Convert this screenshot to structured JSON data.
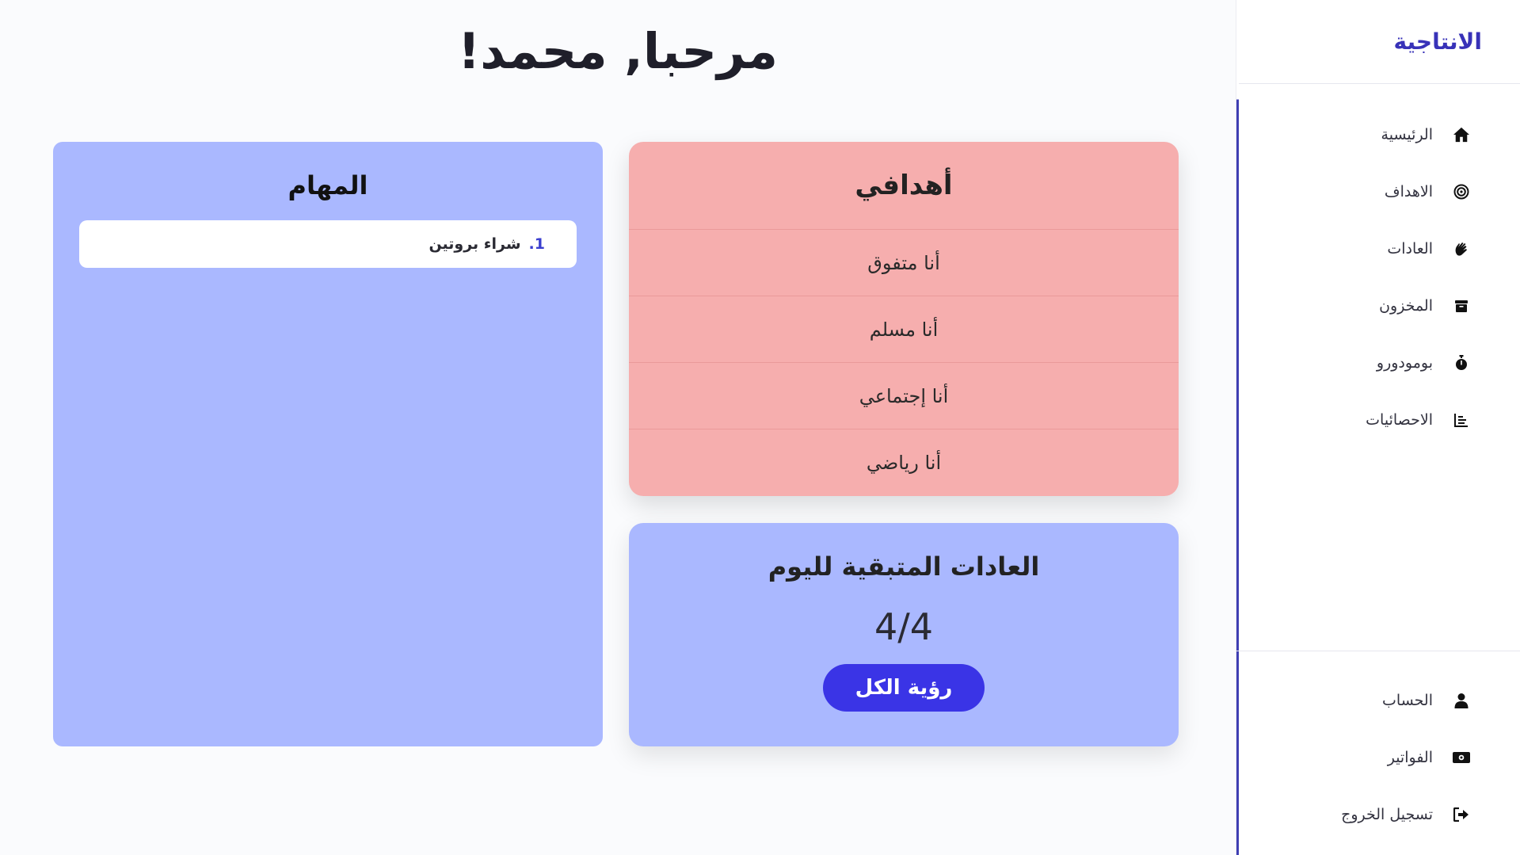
{
  "app": {
    "brand": "الانتاجية"
  },
  "sidebar": {
    "items": [
      {
        "label": "الرئيسية",
        "icon": "home-icon"
      },
      {
        "label": "الاهداف",
        "icon": "target-icon"
      },
      {
        "label": "العادات",
        "icon": "hand-icon"
      },
      {
        "label": "المخزون",
        "icon": "box-icon"
      },
      {
        "label": "بومودورو",
        "icon": "stopwatch-icon"
      },
      {
        "label": "الاحصائيات",
        "icon": "chart-icon"
      }
    ],
    "bottom_items": [
      {
        "label": "الحساب",
        "icon": "user-icon"
      },
      {
        "label": "الفواتير",
        "icon": "money-icon"
      },
      {
        "label": "تسجيل الخروج",
        "icon": "logout-icon"
      }
    ]
  },
  "main": {
    "greeting": "مرحبا, محمد!",
    "tasks": {
      "title": "المهام",
      "items": [
        {
          "num": "1.",
          "text": "شراء بروتين"
        }
      ]
    },
    "goals": {
      "title": "أهدافي",
      "items": [
        "أنا متفوق",
        "أنا مسلم",
        "أنا إجتماعي",
        "أنا رياضي"
      ]
    },
    "habits": {
      "title": "العادات المتبقية لليوم",
      "count": "4/4",
      "button": "رؤية الكل"
    }
  },
  "colors": {
    "brand": "#3832b8",
    "tasks_bg": "#aab8ff",
    "goals_bg": "#f6aeae",
    "button": "#3a34e6"
  }
}
